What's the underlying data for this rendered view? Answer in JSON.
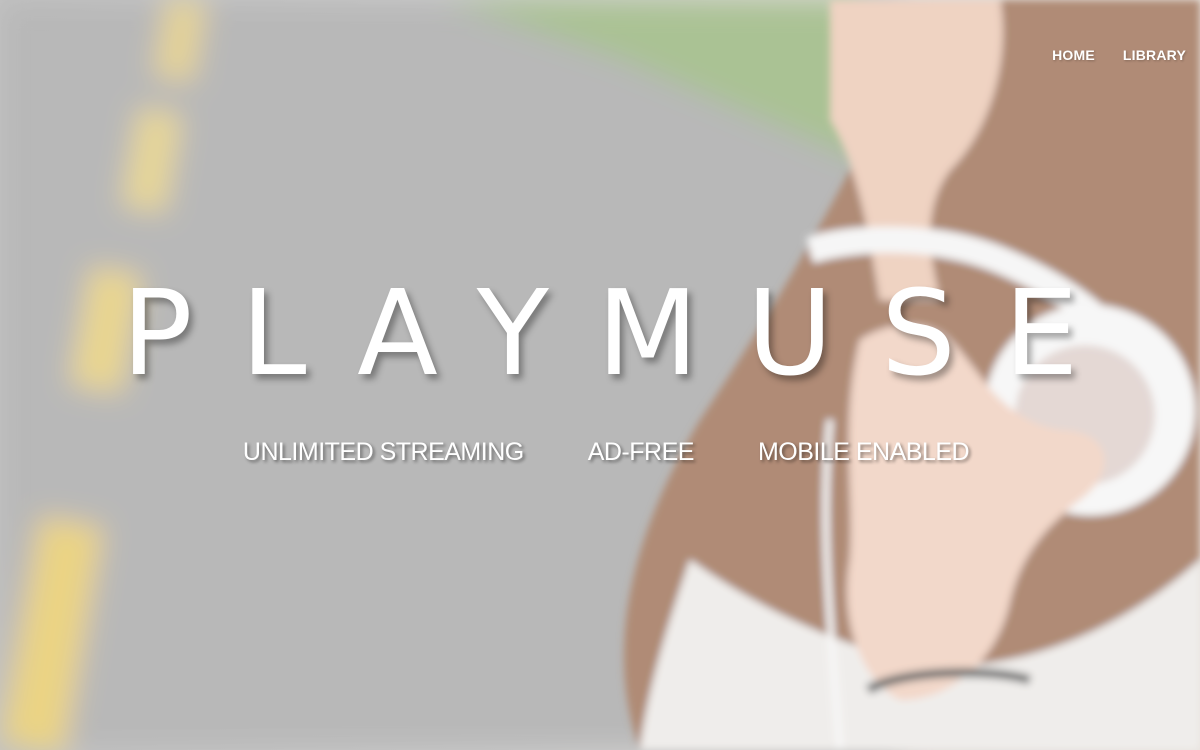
{
  "nav": {
    "items": [
      {
        "label": "HOME"
      },
      {
        "label": "LIBRARY"
      }
    ]
  },
  "hero": {
    "title": "PLAYMUSE",
    "features": [
      {
        "label": "UNLIMITED STREAMING"
      },
      {
        "label": "AD-FREE"
      },
      {
        "label": "MOBILE ENABLED"
      }
    ]
  },
  "colors": {
    "text": "#ffffff",
    "road": "#9e9e9e",
    "road_marking": "#e0c24a",
    "grass": "#7fa55a",
    "hair": "#8b5a3c",
    "skin": "#e9c3ad"
  }
}
